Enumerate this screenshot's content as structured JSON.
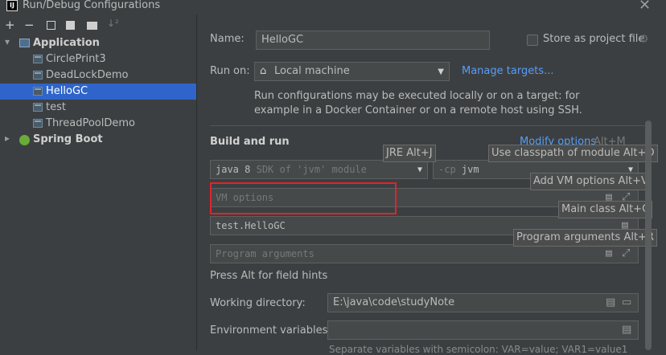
{
  "window": {
    "title": "Run/Debug Configurations",
    "close_glyph": "✕"
  },
  "toolbar": {
    "add": "+",
    "remove": "−",
    "copy": "⧉",
    "save": "💾",
    "move": "📁",
    "sort": "↓²"
  },
  "tree": {
    "application": {
      "label": "Application"
    },
    "items": [
      {
        "label": "CirclePrint3"
      },
      {
        "label": "DeadLockDemo"
      },
      {
        "label": "HelloGC"
      },
      {
        "label": "test"
      },
      {
        "label": "ThreadPoolDemo"
      }
    ],
    "spring": {
      "label": "Spring Boot"
    }
  },
  "form": {
    "name_label": "Name:",
    "name_value": "HelloGC",
    "store_label": "Store as project file",
    "run_on_label": "Run on:",
    "run_on_value": "Local machine",
    "manage_targets": "Manage targets...",
    "run_hint_1": "Run configurations may be executed locally or on a target: for",
    "run_hint_2": "example in a Docker Container or on a remote host using SSH.",
    "build_run_title": "Build and run",
    "modify_options": "Modify options",
    "modify_shortcut": "Alt+M",
    "jre_tip": "JRE Alt+J",
    "classpath_tip": "Use classpath of module Alt+O",
    "sdk_value": "java 8",
    "sdk_suffix": "SDK of 'jvm' module",
    "cp_prefix": "-cp",
    "cp_value": "jvm",
    "vm_tip": "Add VM options Alt+V",
    "vm_placeholder": "VM options",
    "main_class_tip": "Main class Alt+C",
    "main_class_value": "test.HelloGC",
    "prog_args_tip": "Program arguments Alt+R",
    "prog_args_placeholder": "Program arguments",
    "field_hint": "Press Alt for field hints",
    "workdir_label": "Working directory:",
    "workdir_value": "E:\\java\\code\\studyNote",
    "env_label": "Environment variables:",
    "env_hint": "Separate variables with semicolon: VAR=value; VAR1=value1"
  }
}
